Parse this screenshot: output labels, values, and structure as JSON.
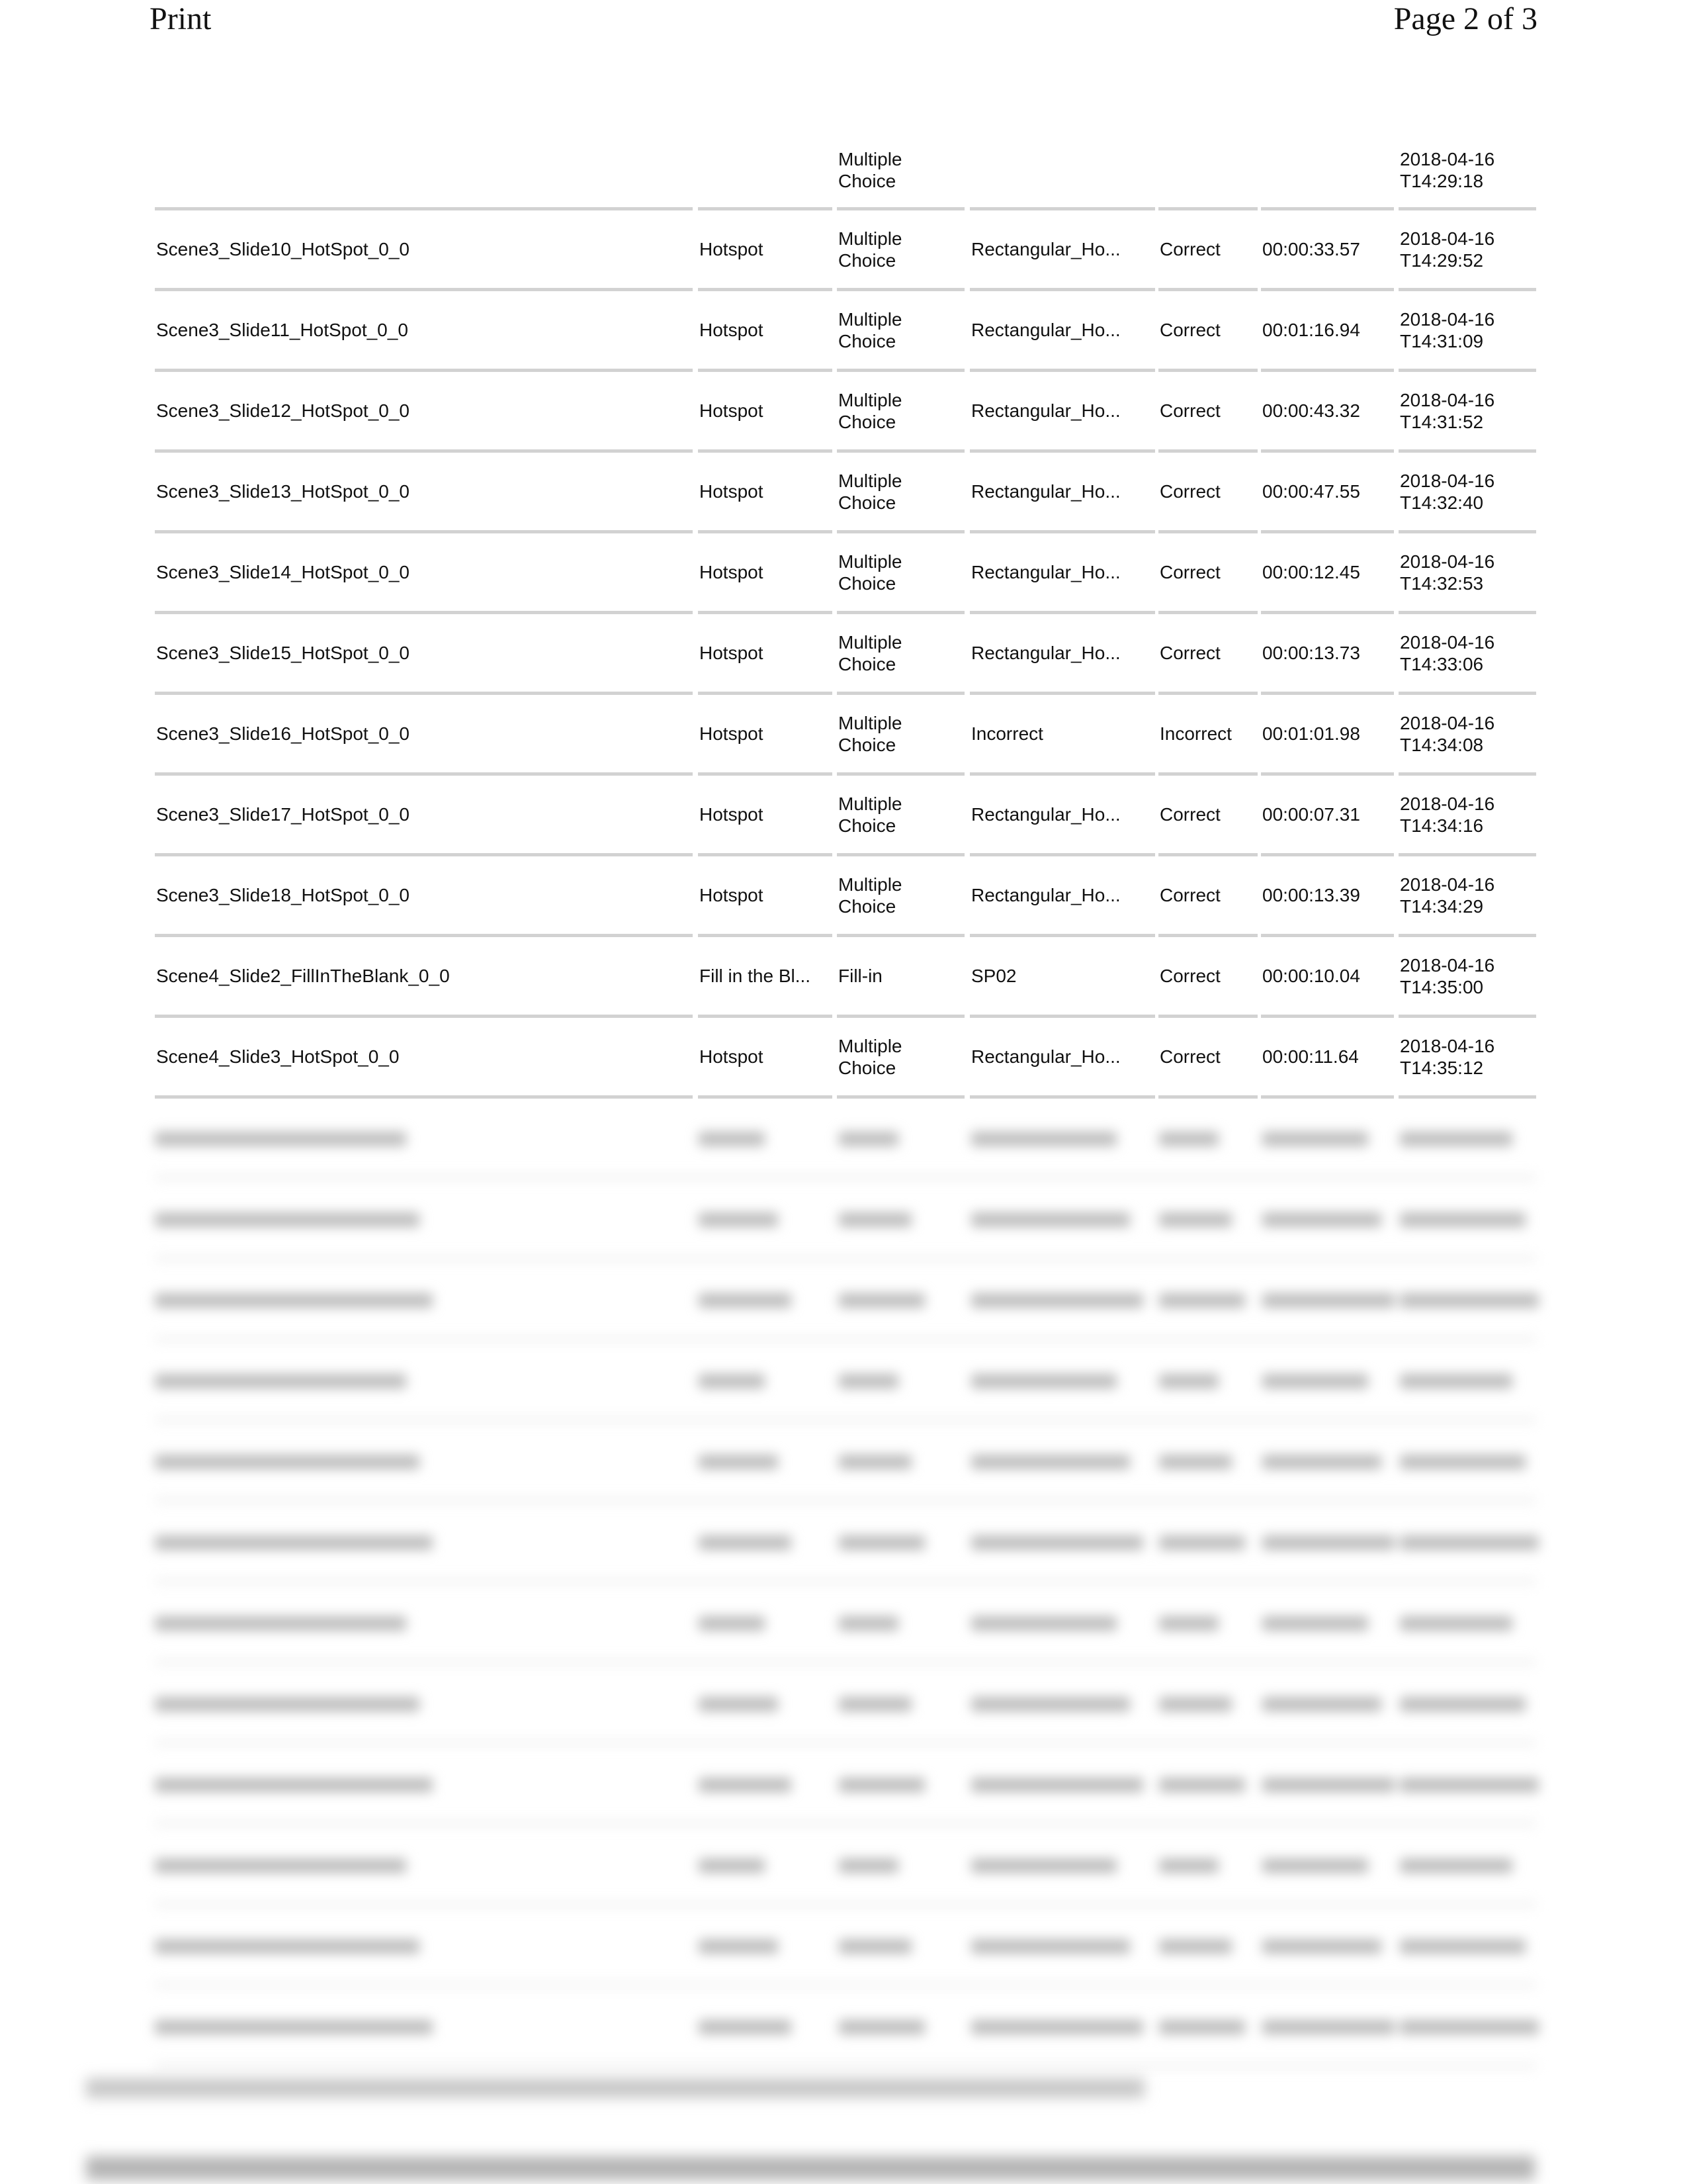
{
  "header": {
    "left": "Print",
    "right": "Page 2 of 3"
  },
  "rows": [
    {
      "id": "",
      "type": "",
      "interaction": "Multiple Choice",
      "response": "",
      "result": "",
      "latency": "",
      "date": "2018-04-16T14:29:18"
    },
    {
      "id": "Scene3_Slide10_HotSpot_0_0",
      "type": "Hotspot",
      "interaction": "Multiple Choice",
      "response": "Rectangular_Ho...",
      "result": "Correct",
      "latency": "00:00:33.57",
      "date": "2018-04-16T14:29:52"
    },
    {
      "id": "Scene3_Slide11_HotSpot_0_0",
      "type": "Hotspot",
      "interaction": "Multiple Choice",
      "response": "Rectangular_Ho...",
      "result": "Correct",
      "latency": "00:01:16.94",
      "date": "2018-04-16T14:31:09"
    },
    {
      "id": "Scene3_Slide12_HotSpot_0_0",
      "type": "Hotspot",
      "interaction": "Multiple Choice",
      "response": "Rectangular_Ho...",
      "result": "Correct",
      "latency": "00:00:43.32",
      "date": "2018-04-16T14:31:52"
    },
    {
      "id": "Scene3_Slide13_HotSpot_0_0",
      "type": "Hotspot",
      "interaction": "Multiple Choice",
      "response": "Rectangular_Ho...",
      "result": "Correct",
      "latency": "00:00:47.55",
      "date": "2018-04-16T14:32:40"
    },
    {
      "id": "Scene3_Slide14_HotSpot_0_0",
      "type": "Hotspot",
      "interaction": "Multiple Choice",
      "response": "Rectangular_Ho...",
      "result": "Correct",
      "latency": "00:00:12.45",
      "date": "2018-04-16T14:32:53"
    },
    {
      "id": "Scene3_Slide15_HotSpot_0_0",
      "type": "Hotspot",
      "interaction": "Multiple Choice",
      "response": "Rectangular_Ho...",
      "result": "Correct",
      "latency": "00:00:13.73",
      "date": "2018-04-16T14:33:06"
    },
    {
      "id": "Scene3_Slide16_HotSpot_0_0",
      "type": "Hotspot",
      "interaction": "Multiple Choice",
      "response": "Incorrect",
      "result": "Incorrect",
      "latency": "00:01:01.98",
      "date": "2018-04-16T14:34:08"
    },
    {
      "id": "Scene3_Slide17_HotSpot_0_0",
      "type": "Hotspot",
      "interaction": "Multiple Choice",
      "response": "Rectangular_Ho...",
      "result": "Correct",
      "latency": "00:00:07.31",
      "date": "2018-04-16T14:34:16"
    },
    {
      "id": "Scene3_Slide18_HotSpot_0_0",
      "type": "Hotspot",
      "interaction": "Multiple Choice",
      "response": "Rectangular_Ho...",
      "result": "Correct",
      "latency": "00:00:13.39",
      "date": "2018-04-16T14:34:29"
    },
    {
      "id": "Scene4_Slide2_FillInTheBlank_0_0",
      "type": "Fill in the Bl...",
      "interaction": "Fill-in",
      "response": "SP02",
      "result": "Correct",
      "latency": "00:00:10.04",
      "date": "2018-04-16T14:35:00"
    },
    {
      "id": "Scene4_Slide3_HotSpot_0_0",
      "type": "Hotspot",
      "interaction": "Multiple Choice",
      "response": "Rectangular_Ho...",
      "result": "Correct",
      "latency": "00:00:11.64",
      "date": "2018-04-16T14:35:12"
    }
  ]
}
